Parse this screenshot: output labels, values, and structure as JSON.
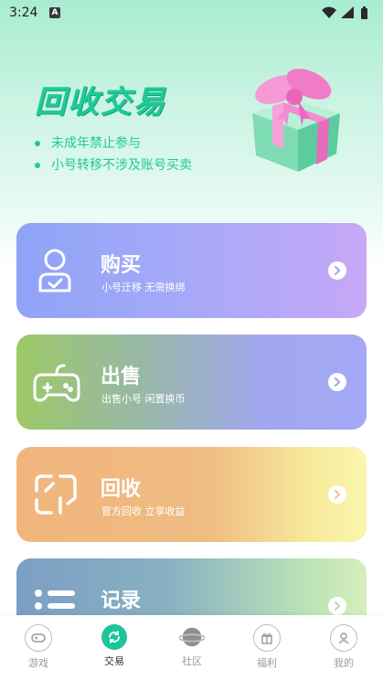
{
  "status_bar": {
    "time": "3:24",
    "app_badge": "A"
  },
  "hero": {
    "title": "回收交易",
    "notes": [
      "未成年禁止参与",
      "小号转移不涉及账号买卖"
    ]
  },
  "cards": [
    {
      "title": "购买",
      "subtitle": "小号迁移 无需换绑",
      "icon": "user-icon"
    },
    {
      "title": "出售",
      "subtitle": "出售小号 闲置换币",
      "icon": "gamepad-icon"
    },
    {
      "title": "回收",
      "subtitle": "官方回收 立享收益",
      "icon": "recycle-icon"
    },
    {
      "title": "记录",
      "subtitle": "",
      "icon": "list-icon"
    }
  ],
  "nav": [
    {
      "label": "游戏",
      "icon": "game-icon",
      "active": false
    },
    {
      "label": "交易",
      "icon": "trade-icon",
      "active": true
    },
    {
      "label": "社区",
      "icon": "planet-icon",
      "active": false
    },
    {
      "label": "福利",
      "icon": "gift-icon",
      "active": false
    },
    {
      "label": "我的",
      "icon": "profile-icon",
      "active": false
    }
  ],
  "colors": {
    "accent": "#20c997",
    "nav_active": "#1dc59a"
  }
}
